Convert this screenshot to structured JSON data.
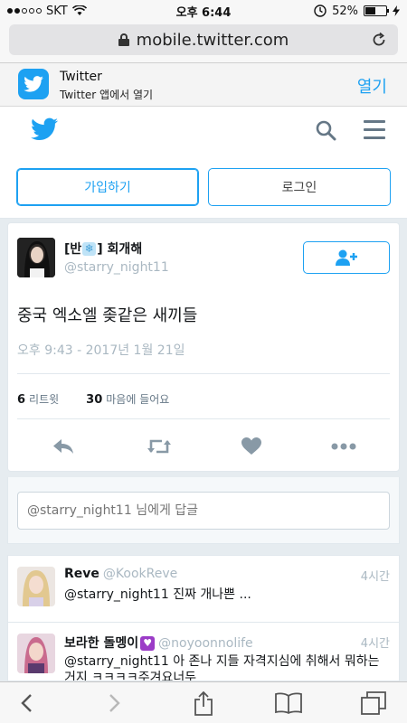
{
  "status_bar": {
    "carrier": "SKT",
    "time": "오후 6:44",
    "battery": "52%"
  },
  "browser": {
    "url": "mobile.twitter.com"
  },
  "app_banner": {
    "name": "Twitter",
    "subtitle": "Twitter 앱에서 열기",
    "open_label": "열기"
  },
  "auth": {
    "signup_label": "가입하기",
    "login_label": "로그인"
  },
  "tweet": {
    "name_prefix": "[반",
    "name_suffix": "] 회개해",
    "handle": "@starry_night11",
    "text": "중국 엑소엘 좆같은 새끼들",
    "timestamp": "오후 9:43 - 2017년 1월 21일",
    "retweet_count": "6",
    "retweet_label": "리트윗",
    "like_count": "30",
    "like_label": "마음에 들어요"
  },
  "reply_box": {
    "placeholder": "@starry_night11 님에게 답글"
  },
  "replies": [
    {
      "name": "Reve",
      "handle": "@KookReve",
      "time": "4시간",
      "text": "@starry_night11 진짜 개나쁜 ..."
    },
    {
      "name": "보라한 돌멩이",
      "handle": "@noyoonnolife",
      "time": "4시간",
      "text": "@starry_night11 아 존나 지들 자격지심에 취해서 뭐하는 거지 ㅋㅋㅋㅋ주겨요너두"
    }
  ],
  "colors": {
    "accent": "#1da1f2",
    "muted": "#aab8c2",
    "text": "#14171a",
    "heart_badge": "#9b3cc7"
  },
  "icons": [
    "signal-dots-icon",
    "wifi-icon",
    "alarm-icon",
    "battery-icon",
    "lock-icon",
    "reload-icon",
    "twitter-bird-icon",
    "search-icon",
    "menu-icon",
    "add-user-icon",
    "reply-icon",
    "retweet-icon",
    "like-icon",
    "more-icon",
    "back-icon",
    "forward-icon",
    "share-icon",
    "bookmarks-icon",
    "tabs-icon"
  ]
}
